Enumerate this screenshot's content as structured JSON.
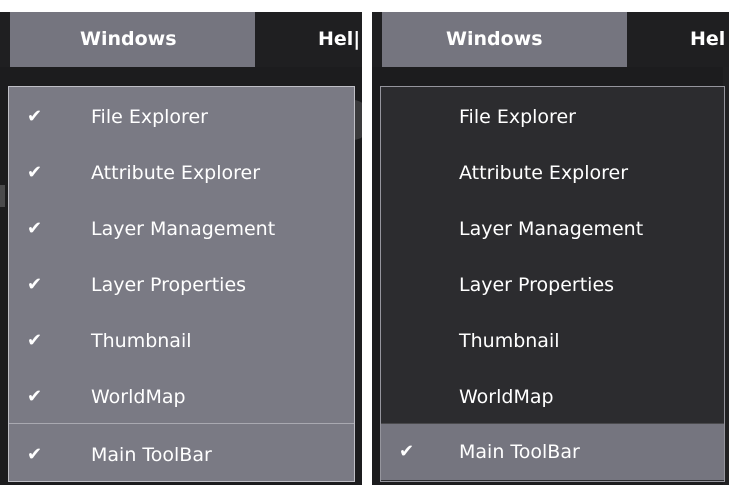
{
  "menubar": {
    "windows_label": "Windows",
    "help_label_left": "Hel|",
    "help_label_right": "Hel"
  },
  "left_menu": {
    "items": [
      {
        "label": "File Explorer",
        "check": "✔"
      },
      {
        "label": "Attribute Explorer",
        "check": "✔"
      },
      {
        "label": "Layer Management",
        "check": "✔"
      },
      {
        "label": "Layer Properties",
        "check": "✔"
      },
      {
        "label": "Thumbnail",
        "check": "✔"
      },
      {
        "label": "WorldMap",
        "check": "✔"
      },
      {
        "label": "Main ToolBar",
        "check": "✔"
      }
    ]
  },
  "right_menu": {
    "items": [
      {
        "label": "File Explorer"
      },
      {
        "label": "Attribute Explorer"
      },
      {
        "label": "Layer Management"
      },
      {
        "label": "Layer Properties"
      },
      {
        "label": "Thumbnail"
      },
      {
        "label": "WorldMap"
      },
      {
        "label": "Main ToolBar",
        "check": "✔"
      }
    ]
  },
  "colors": {
    "menubar_bg": "#1f1f21",
    "active_menu_bg": "#75757f",
    "dropdown_left_bg": "#7a7a84",
    "dropdown_right_bg": "#2c2c2f",
    "text": "#ffffff"
  }
}
